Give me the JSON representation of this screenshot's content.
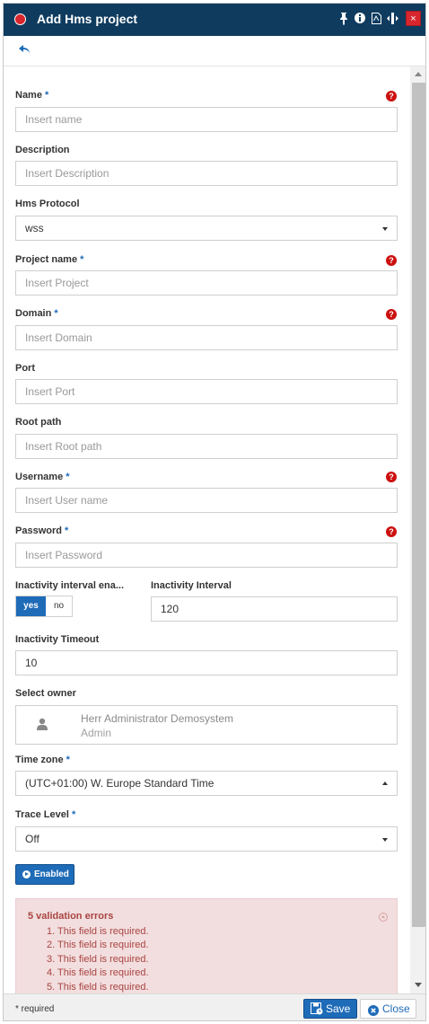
{
  "window": {
    "title": "Add Hms project"
  },
  "titlebar_icons": [
    "pin-icon",
    "info-icon",
    "pdf-icon",
    "resize-icon",
    "close-icon"
  ],
  "close_symbol": "×",
  "fields": {
    "name": {
      "label": "Name",
      "required": "*",
      "placeholder": "Insert name"
    },
    "description": {
      "label": "Description",
      "placeholder": "Insert Description"
    },
    "hms_protocol": {
      "label": "Hms Protocol",
      "value": "wss"
    },
    "project_name": {
      "label": "Project name",
      "required": "*",
      "placeholder": "Insert Project"
    },
    "domain": {
      "label": "Domain",
      "required": "*",
      "placeholder": "Insert Domain"
    },
    "port": {
      "label": "Port",
      "placeholder": "Insert Port"
    },
    "root_path": {
      "label": "Root path",
      "placeholder": "Insert Root path"
    },
    "username": {
      "label": "Username",
      "required": "*",
      "placeholder": "Insert User name"
    },
    "password": {
      "label": "Password",
      "required": "*",
      "placeholder": "Insert Password"
    },
    "inactivity_enabled": {
      "label": "Inactivity interval ena...",
      "yes": "yes",
      "no": "no",
      "selected": "yes"
    },
    "inactivity_interval": {
      "label": "Inactivity Interval",
      "value": "120"
    },
    "inactivity_timeout": {
      "label": "Inactivity Timeout",
      "value": "10"
    },
    "owner": {
      "label": "Select owner",
      "name": "Herr Administrator Demosystem",
      "role": "Admin"
    },
    "time_zone": {
      "label": "Time zone",
      "required": "*",
      "value": "(UTC+01:00) W. Europe Standard Time"
    },
    "trace_level": {
      "label": "Trace Level",
      "required": "*",
      "value": "Off"
    }
  },
  "enabled_button": {
    "label": "Enabled"
  },
  "validation": {
    "title": "5 validation errors",
    "items": [
      "1. This field is required.",
      "2. This field is required.",
      "3. This field is required.",
      "4. This field is required.",
      "5. This field is required."
    ]
  },
  "footer": {
    "required_note": "* required",
    "save_label": "Save",
    "close_label": "Close"
  },
  "colors": {
    "titlebar": "#0f3b5f",
    "accent": "#1e6bb8",
    "error_text": "#a94442",
    "error_bg": "#f2dede",
    "help": "#cc1010"
  }
}
